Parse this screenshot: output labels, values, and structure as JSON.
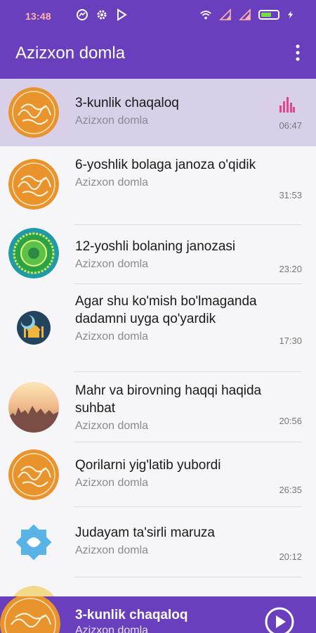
{
  "status": {
    "time": "13:48",
    "colors": {
      "time": "#ffb3a8",
      "battery": "#7bdc4a"
    },
    "icons": [
      "messenger-icon",
      "gear-icon",
      "play-store-icon",
      "wifi-icon",
      "signal-icon",
      "signal-4g-icon",
      "battery-icon",
      "charging-icon"
    ]
  },
  "app": {
    "title": "Azizxon domla",
    "accent": "#6a3fbd",
    "menu_icon": "more-vert-icon"
  },
  "tracks": [
    {
      "title": "3-kunlik chaqaloq",
      "artist": "Azizxon domla",
      "duration": "06:47",
      "thumb": "calligraphy",
      "active": true
    },
    {
      "title": "6-yoshlik bolaga janoza o'qidik",
      "artist": "Azizxon domla",
      "duration": "31:53",
      "thumb": "calligraphy"
    },
    {
      "title": "12-yoshli bolaning janozasi",
      "artist": "Azizxon domla",
      "duration": "23:20",
      "thumb": "mandala"
    },
    {
      "title": "Agar shu ko'mish bo'lmaganda dadamni uyga qo'yardik",
      "artist": "Azizxon domla",
      "duration": "17:30",
      "thumb": "mosque"
    },
    {
      "title": "Mahr va birovning haqqi haqida suhbat",
      "artist": "Azizxon domla",
      "duration": "20:56",
      "thumb": "sunset"
    },
    {
      "title": "Qorilarni yig'latib yubordi",
      "artist": "Azizxon domla",
      "duration": "26:35",
      "thumb": "calligraphy"
    },
    {
      "title": "Judayam ta'sirli maruza",
      "artist": "Azizxon domla",
      "duration": "20:12",
      "thumb": "star"
    }
  ],
  "player": {
    "title": "3-kunlik chaqaloq",
    "artist": "Azizxon domla",
    "play_icon": "play-icon"
  }
}
